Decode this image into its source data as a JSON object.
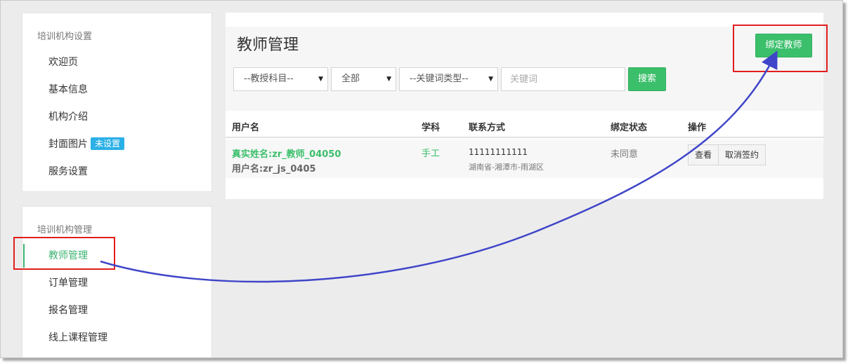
{
  "sidebar": {
    "settings": {
      "title": "培训机构设置",
      "items": [
        {
          "label": "欢迎页"
        },
        {
          "label": "基本信息"
        },
        {
          "label": "机构介绍"
        },
        {
          "label": "封面图片",
          "badge": "未设置"
        },
        {
          "label": "服务设置"
        }
      ]
    },
    "manage": {
      "title": "培训机构管理",
      "items": [
        {
          "label": "教师管理",
          "active": true
        },
        {
          "label": "订单管理"
        },
        {
          "label": "报名管理"
        },
        {
          "label": "线上课程管理"
        }
      ]
    }
  },
  "main": {
    "title": "教师管理",
    "bind_button": "绑定教师",
    "filters": {
      "subject": "--教授科目--",
      "status": "全部",
      "keyword_type": "--关键词类型--",
      "keyword_placeholder": "关键词",
      "search_button": "搜索"
    },
    "table": {
      "headers": [
        "用户名",
        "学科",
        "联系方式",
        "绑定状态",
        "操作"
      ],
      "rows": [
        {
          "real_name": "真实姓名:zr_教师_04050",
          "username": "用户名:zr_js_0405",
          "subject": "手工",
          "phone": "11111111111",
          "address": "湖南省-湘潭市-雨湖区",
          "status": "未同意",
          "actions": [
            "查看",
            "取消签约"
          ]
        }
      ]
    }
  },
  "annotations": {
    "highlight_color": "#e21d1d",
    "arrow_color": "#3f45c8"
  },
  "colors": {
    "accent_green": "#3bbf6b",
    "badge_blue": "#2ab0e6"
  }
}
